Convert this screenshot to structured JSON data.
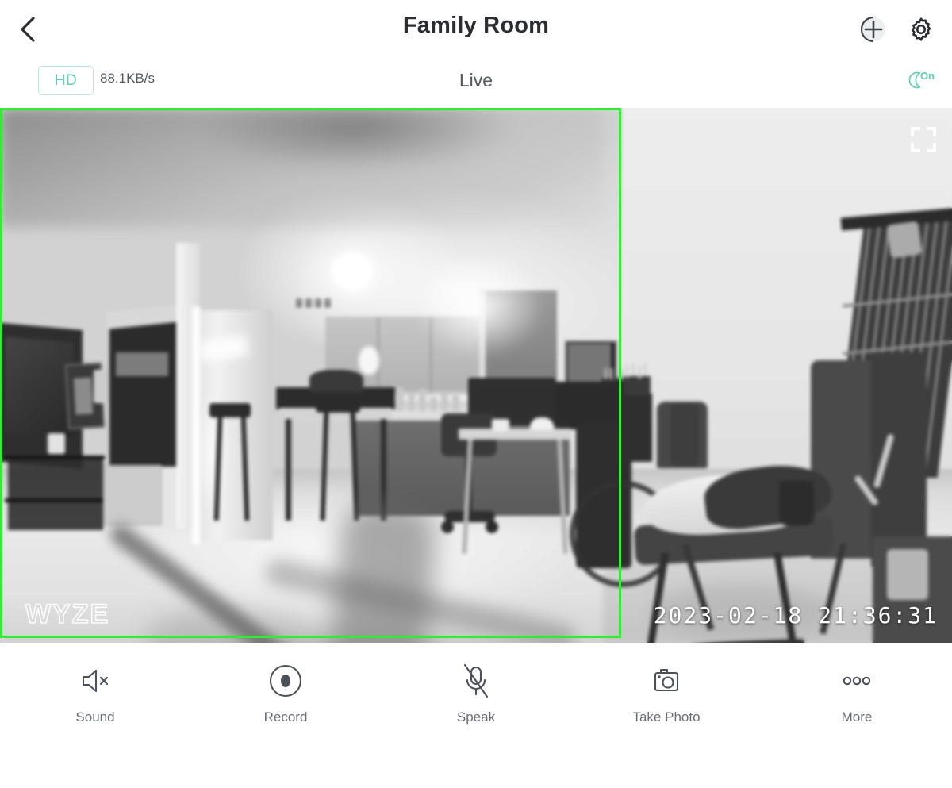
{
  "header": {
    "title": "Family Room",
    "back_icon": "chevron-left-icon",
    "add_icon": "add-device-icon",
    "settings_icon": "gear-icon"
  },
  "subbar": {
    "quality_badge": "HD",
    "bitrate": "88.1KB/s",
    "stream_mode": "Live",
    "night_mode_icon": "moon-icon",
    "night_mode_state": "On"
  },
  "video": {
    "timestamp": "2023-02-18 21:36:31",
    "watermark": "WYZE",
    "fullscreen_icon": "fullscreen-icon",
    "detection_zone_color": "#3ae63a",
    "is_night_vision": true
  },
  "toolbar": {
    "items": [
      {
        "label": "Sound",
        "icon": "speaker-muted-icon"
      },
      {
        "label": "Record",
        "icon": "record-icon"
      },
      {
        "label": "Speak",
        "icon": "microphone-muted-icon"
      },
      {
        "label": "Take Photo",
        "icon": "camera-icon"
      },
      {
        "label": "More",
        "icon": "more-dots-icon"
      }
    ]
  },
  "colors": {
    "accent_teal": "#5fcfae",
    "title": "#2b2d33",
    "muted_text": "#6a6d73",
    "zone_green": "#3ae63a"
  }
}
